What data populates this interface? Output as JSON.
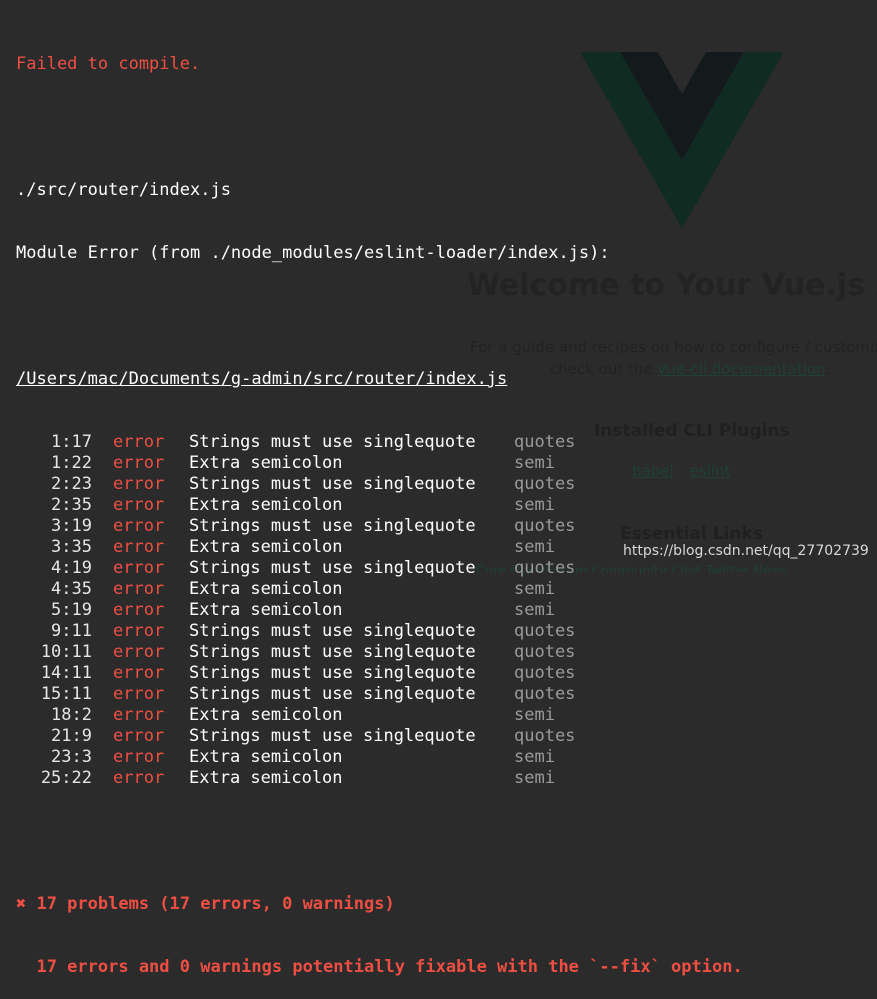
{
  "header": {
    "status": "Failed to compile.",
    "file_path": "./src/router/index.js",
    "module_error": "Module Error (from ./node_modules/eslint-loader/index.js):",
    "absolute_path": "/Users/mac/Documents/g-admin/src/router/index.js"
  },
  "errors": [
    {
      "loc": "1:17",
      "severity": "error",
      "message": "Strings must use singlequote",
      "rule": "quotes"
    },
    {
      "loc": "1:22",
      "severity": "error",
      "message": "Extra semicolon",
      "rule": "semi"
    },
    {
      "loc": "2:23",
      "severity": "error",
      "message": "Strings must use singlequote",
      "rule": "quotes"
    },
    {
      "loc": "2:35",
      "severity": "error",
      "message": "Extra semicolon",
      "rule": "semi"
    },
    {
      "loc": "3:19",
      "severity": "error",
      "message": "Strings must use singlequote",
      "rule": "quotes"
    },
    {
      "loc": "3:35",
      "severity": "error",
      "message": "Extra semicolon",
      "rule": "semi"
    },
    {
      "loc": "4:19",
      "severity": "error",
      "message": "Strings must use singlequote",
      "rule": "quotes"
    },
    {
      "loc": "4:35",
      "severity": "error",
      "message": "Extra semicolon",
      "rule": "semi"
    },
    {
      "loc": "5:19",
      "severity": "error",
      "message": "Extra semicolon",
      "rule": "semi"
    },
    {
      "loc": "9:11",
      "severity": "error",
      "message": "Strings must use singlequote",
      "rule": "quotes"
    },
    {
      "loc": "10:11",
      "severity": "error",
      "message": "Strings must use singlequote",
      "rule": "quotes"
    },
    {
      "loc": "14:11",
      "severity": "error",
      "message": "Strings must use singlequote",
      "rule": "quotes"
    },
    {
      "loc": "15:11",
      "severity": "error",
      "message": "Strings must use singlequote",
      "rule": "quotes"
    },
    {
      "loc": "18:2",
      "severity": "error",
      "message": "Extra semicolon",
      "rule": "semi"
    },
    {
      "loc": "21:9",
      "severity": "error",
      "message": "Strings must use singlequote",
      "rule": "quotes"
    },
    {
      "loc": "23:3",
      "severity": "error",
      "message": "Extra semicolon",
      "rule": "semi"
    },
    {
      "loc": "25:22",
      "severity": "error",
      "message": "Extra semicolon",
      "rule": "semi"
    }
  ],
  "summary": {
    "problems": "✖ 17 problems (17 errors, 0 warnings)",
    "fixable": "  17 errors and 0 warnings potentially fixable with the `--fix` option."
  },
  "background_page": {
    "heading": "Welcome to Your Vue.js App",
    "para_line1": "For a guide and recipes on how to configure / customize this project,",
    "para_line2_prefix": "check out the ",
    "para_link": "vue-cli documentation",
    "para_line2_suffix": ".",
    "plugins_title": "Installed CLI Plugins",
    "plugins": [
      "babel",
      "eslint"
    ],
    "essential_title": "Essential Links",
    "essential_links": "Core Docs    Forum    Community Chat    Twitter    News"
  },
  "watermark": "https://blog.csdn.net/qq_27702739",
  "colors": {
    "background": "#2b2b2b",
    "error_red": "#ef4f43",
    "rule_gray": "#9a9a9a",
    "vue_logo": "#0f2f24"
  }
}
